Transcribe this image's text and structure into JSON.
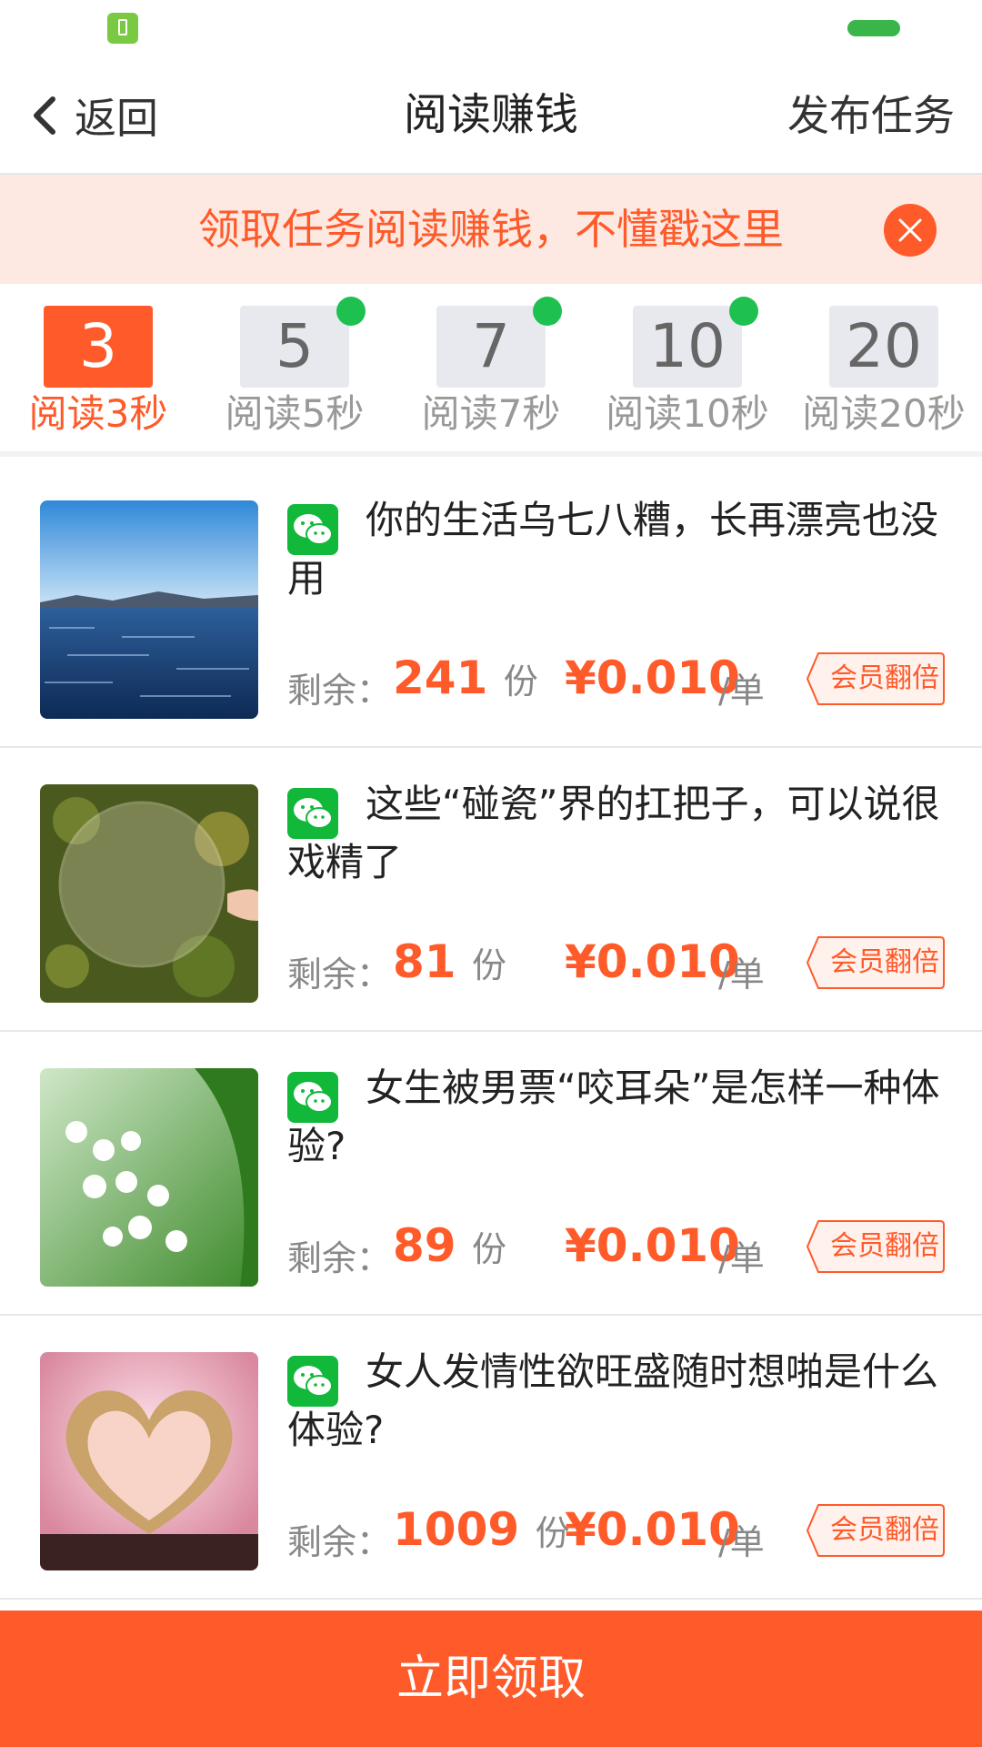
{
  "status_bar": {
    "battery_icon": "battery-icon",
    "signal_indicator": "signal-indicator"
  },
  "header": {
    "back_label": "返回",
    "title": "阅读赚钱",
    "publish_label": "发布任务"
  },
  "banner": {
    "text": "领取任务阅读赚钱，不懂戳这里",
    "close_icon": "close-icon"
  },
  "tabs": [
    {
      "number": "3",
      "label": "阅读3秒",
      "active": true,
      "dot": false
    },
    {
      "number": "5",
      "label": "阅读5秒",
      "active": false,
      "dot": true
    },
    {
      "number": "7",
      "label": "阅读7秒",
      "active": false,
      "dot": true
    },
    {
      "number": "10",
      "label": "阅读10秒",
      "active": false,
      "dot": true
    },
    {
      "number": "20",
      "label": "阅读20秒",
      "active": false,
      "dot": false
    }
  ],
  "items": [
    {
      "title": "你的生活乌七八糟，长再漂亮也没用",
      "remain_label": "剩余：",
      "remain": "241",
      "unit": "份",
      "price": "¥0.010",
      "per": "/单",
      "tag": "会员翻倍",
      "thumb": "sea"
    },
    {
      "title": "这些“碰瓷”界的扛把子，可以说很戏精了",
      "remain_label": "剩余：",
      "remain": "81",
      "unit": "份",
      "price": "¥0.010",
      "per": "/单",
      "tag": "会员翻倍",
      "thumb": "bubble"
    },
    {
      "title": "女生被男票“咬耳朵”是怎样一种体验?",
      "remain_label": "剩余：",
      "remain": "89",
      "unit": "份",
      "price": "¥0.010",
      "per": "/单",
      "tag": "会员翻倍",
      "thumb": "flowers"
    },
    {
      "title": "女人发情性欲旺盛随时想啪是什么体验?",
      "remain_label": "剩余：",
      "remain": "1009",
      "unit": "份",
      "price": "¥0.010",
      "per": "/单",
      "tag": "会员翻倍",
      "thumb": "heart-book"
    }
  ],
  "cta": {
    "label": "立即领取"
  },
  "colors": {
    "accent": "#ff5a2a",
    "banner_bg": "#fde9e2",
    "wechat_green": "#12b83a",
    "dot_green": "#1ec14f"
  }
}
